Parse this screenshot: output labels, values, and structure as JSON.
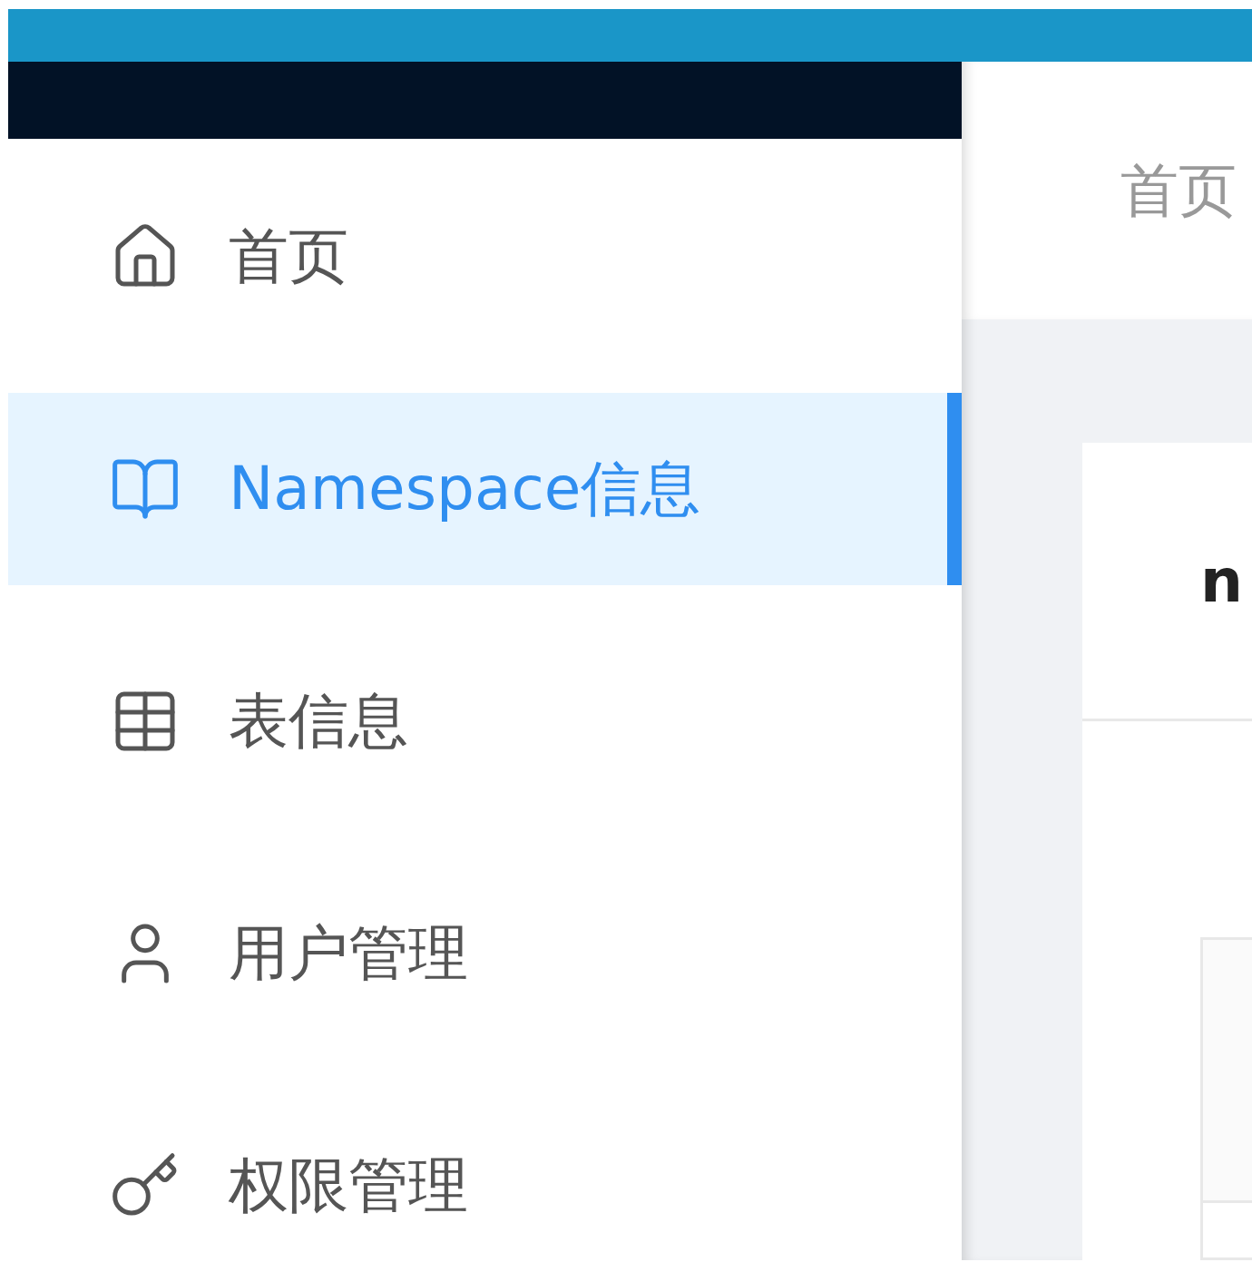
{
  "sidebar": {
    "items": [
      {
        "label": "首页",
        "selected": false
      },
      {
        "label": "Namespace信息",
        "selected": true
      },
      {
        "label": "表信息",
        "selected": false
      },
      {
        "label": "用户管理",
        "selected": false
      },
      {
        "label": "权限管理",
        "selected": false
      }
    ]
  },
  "header": {
    "breadcrumb": "首页"
  },
  "card": {
    "title": "n"
  }
}
